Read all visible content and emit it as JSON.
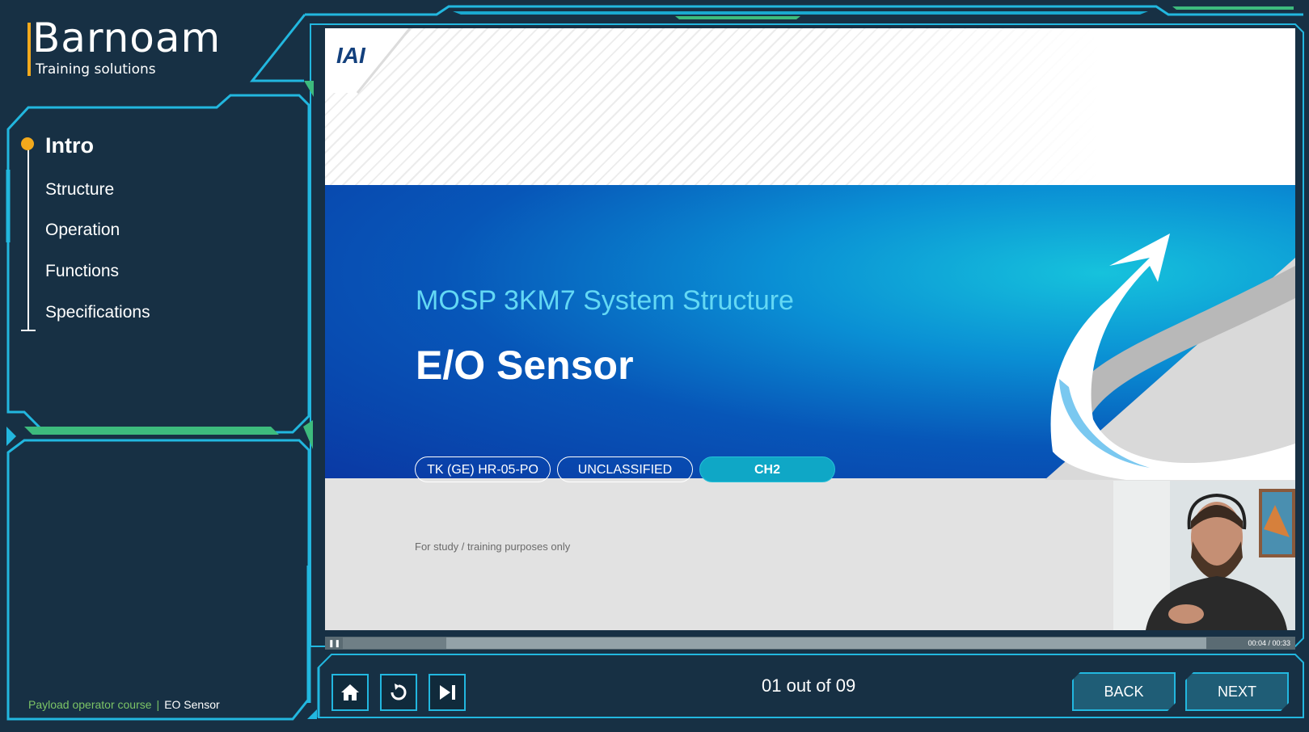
{
  "brand": {
    "name": "Barnoam",
    "tagline": "Training solutions"
  },
  "sidebar": {
    "items": [
      {
        "label": "Intro",
        "active": true
      },
      {
        "label": "Structure",
        "active": false
      },
      {
        "label": "Operation",
        "active": false
      },
      {
        "label": "Functions",
        "active": false
      },
      {
        "label": "Specifications",
        "active": false
      }
    ]
  },
  "breadcrumb": {
    "course": "Payload operator course",
    "separator": "|",
    "page": "EO Sensor"
  },
  "slide": {
    "logo": "IAI",
    "subtitle": "MOSP 3KM7 System Structure",
    "title": "E/O Sensor",
    "tags": [
      "TK (GE) HR-05-PO",
      "UNCLASSIFIED",
      "CH2"
    ],
    "note": "For study / training purposes only"
  },
  "video": {
    "time": "00:04 / 00:33",
    "progress": 0.12,
    "state": "playing",
    "pause_icon": "pause-icon"
  },
  "controls": {
    "home_icon": "home-icon",
    "replay_icon": "replay-icon",
    "skip_icon": "skip-end-icon",
    "page_counter": "01 out of 09",
    "back_label": "BACK",
    "next_label": "NEXT"
  },
  "colors": {
    "frame": "#22b7df",
    "accent_green": "#7cc466",
    "active_dot": "#f2a91c",
    "background": "#173044"
  }
}
